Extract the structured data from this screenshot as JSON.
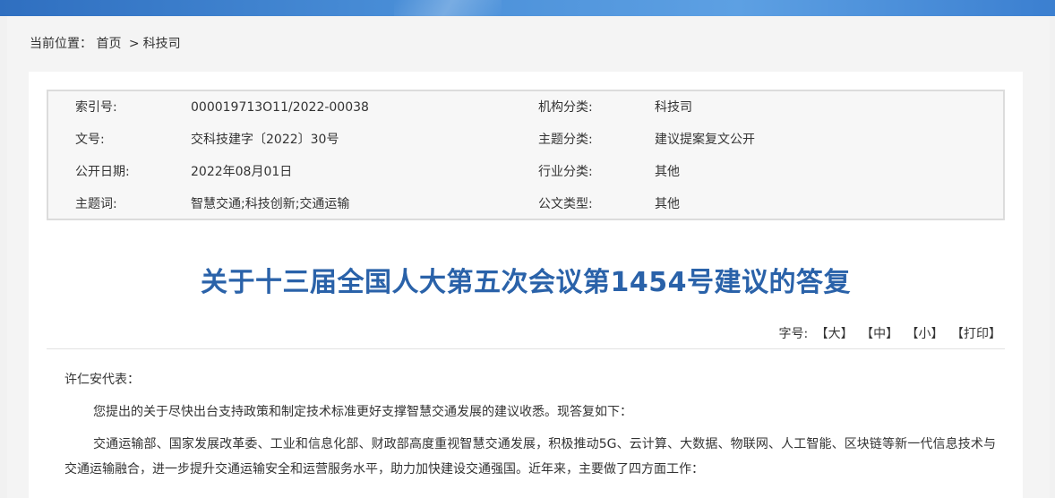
{
  "breadcrumb": {
    "prefix": "当前位置：",
    "home": "首页",
    "separator": ">",
    "current": "科技司"
  },
  "meta": {
    "rows": [
      {
        "label1": "索引号:",
        "value1": "000019713O11/2022-00038",
        "label2": "机构分类:",
        "value2": "科技司"
      },
      {
        "label1": "文号:",
        "value1": "交科技建字〔2022〕30号",
        "label2": "主题分类:",
        "value2": "建议提案复文公开"
      },
      {
        "label1": "公开日期:",
        "value1": "2022年08月01日",
        "label2": "行业分类:",
        "value2": "其他"
      },
      {
        "label1": "主题词:",
        "value1": "智慧交通;科技创新;交通运输",
        "label2": "公文类型:",
        "value2": "其他"
      }
    ]
  },
  "document": {
    "title": "关于十三届全国人大第五次会议第1454号建议的答复",
    "salutation": "许仁安代表：",
    "paragraphs": [
      "您提出的关于尽快出台支持政策和制定技术标准更好支撑智慧交通发展的建议收悉。现答复如下：",
      "交通运输部、国家发展改革委、工业和信息化部、财政部高度重视智慧交通发展，积极推动5G、云计算、大数据、物联网、人工智能、区块链等新一代信息技术与交通运输融合，进一步提升交通运输安全和运营服务水平，助力加快建设交通强国。近年来，主要做了四方面工作："
    ]
  },
  "font_size_bar": {
    "label": "字号:",
    "large": "【大】",
    "medium": "【中】",
    "small": "【小】",
    "print": "【打印】"
  },
  "colors": {
    "title": "#2a62a9",
    "banner": "#3b7fd0"
  }
}
